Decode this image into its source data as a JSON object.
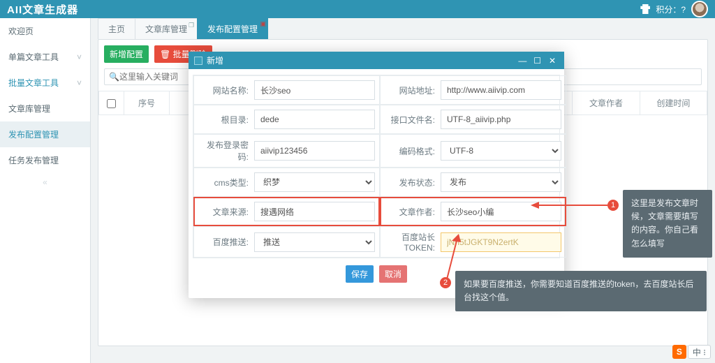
{
  "topbar": {
    "title": "AII文章生成器",
    "points_label": "积分：?",
    "gift_icon": "gift"
  },
  "leftnav": {
    "items": [
      {
        "label": "欢迎页",
        "chev": ""
      },
      {
        "label": "单篇文章工具",
        "chev": "˅"
      },
      {
        "label": "批量文章工具",
        "chev": "˅"
      },
      {
        "label": "文章库管理",
        "chev": ""
      },
      {
        "label": "发布配置管理",
        "chev": ""
      },
      {
        "label": "任务发布管理",
        "chev": ""
      }
    ]
  },
  "tabs": [
    {
      "label": "主页"
    },
    {
      "label": "文章库管理"
    },
    {
      "label": "发布配置管理"
    }
  ],
  "toolbar": {
    "add": "新增配置",
    "del": "批量删除",
    "del_icon": "🗑"
  },
  "search": {
    "placeholder": "这里输入关键词",
    "icon": "🔍"
  },
  "table": {
    "cols": [
      "",
      "序号",
      "",
      "",
      "",
      "",
      "",
      "文章作者",
      "创建时间"
    ]
  },
  "modal": {
    "title": "新增",
    "fields": {
      "site_name": {
        "label": "网站名称:",
        "value": "长沙seo"
      },
      "site_url": {
        "label": "网站地址:",
        "value": "http://www.aiivip.com"
      },
      "root_dir": {
        "label": "根目录:",
        "value": "dede"
      },
      "api_file": {
        "label": "接口文件名:",
        "value": "UTF-8_aiivip.php"
      },
      "pub_pwd": {
        "label": "发布登录密码:",
        "value": "aiivip123456"
      },
      "encoding": {
        "label": "编码格式:",
        "value": "UTF-8"
      },
      "cms_type": {
        "label": "cms类型:",
        "value": "织梦"
      },
      "pub_state": {
        "label": "发布状态:",
        "value": "发布"
      },
      "source": {
        "label": "文章来源:",
        "value": "搜遇网络"
      },
      "author": {
        "label": "文章作者:",
        "value": "长沙seo小编"
      },
      "baidu_push": {
        "label": "百度推送:",
        "value": "推送"
      },
      "baidu_token": {
        "label": "百度站长TOKEN:",
        "value": "jNn5tJGKT9N2ertK"
      }
    },
    "buttons": {
      "save": "保存",
      "cancel": "取消"
    }
  },
  "annotations": {
    "n1": "1",
    "n2": "2",
    "tip1": "这里是发布文章时候，文章需要填写的内容。你自己看怎么填写",
    "tip2": "如果要百度推送，你需要知道百度推送的token，去百度站长后台找这个值。"
  },
  "ime": {
    "a": "S",
    "b": "中 ⁝"
  }
}
